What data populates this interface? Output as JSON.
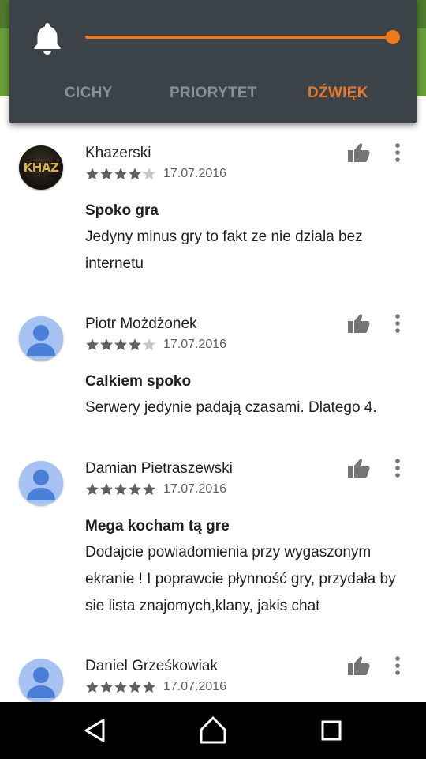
{
  "volume_panel": {
    "icon": "bell-icon",
    "volume_level": 1.0,
    "accent_color": "#ec7a1e",
    "modes": [
      {
        "label": "CICHY",
        "active": false
      },
      {
        "label": "PRIORYTET",
        "active": false
      },
      {
        "label": "DŹWIĘK",
        "active": true
      }
    ]
  },
  "reviews": [
    {
      "name": "Khazerski",
      "avatar": "KHAZ",
      "rating": 4,
      "date": "17.07.2016",
      "title": "Spoko gra",
      "body": "Jedyny minus gry to fakt ze nie dziala bez internetu"
    },
    {
      "name": "Piotr Możdżonek",
      "avatar": "default-user-icon",
      "rating": 4,
      "date": "17.07.2016",
      "title": "Calkiem spoko",
      "body": "Serwery jedynie padają czasami. Dlatego 4."
    },
    {
      "name": "Damian Pietraszewski",
      "avatar": "default-user-icon",
      "rating": 5,
      "date": "17.07.2016",
      "title": "Mega kocham tą gre",
      "body": "Dodajcie powiadomienia przy wygaszonym ekranie ! I poprawcie płynność gry, przydała by sie lista znajomych,klany, jakis chat"
    },
    {
      "name": "Daniel Grześkowiak",
      "avatar": "default-user-icon",
      "rating": 5,
      "date": "17.07.2016",
      "title": "",
      "body": ""
    }
  ],
  "nav_bar": {
    "buttons": [
      "back-icon",
      "home-icon",
      "recents-icon"
    ]
  }
}
